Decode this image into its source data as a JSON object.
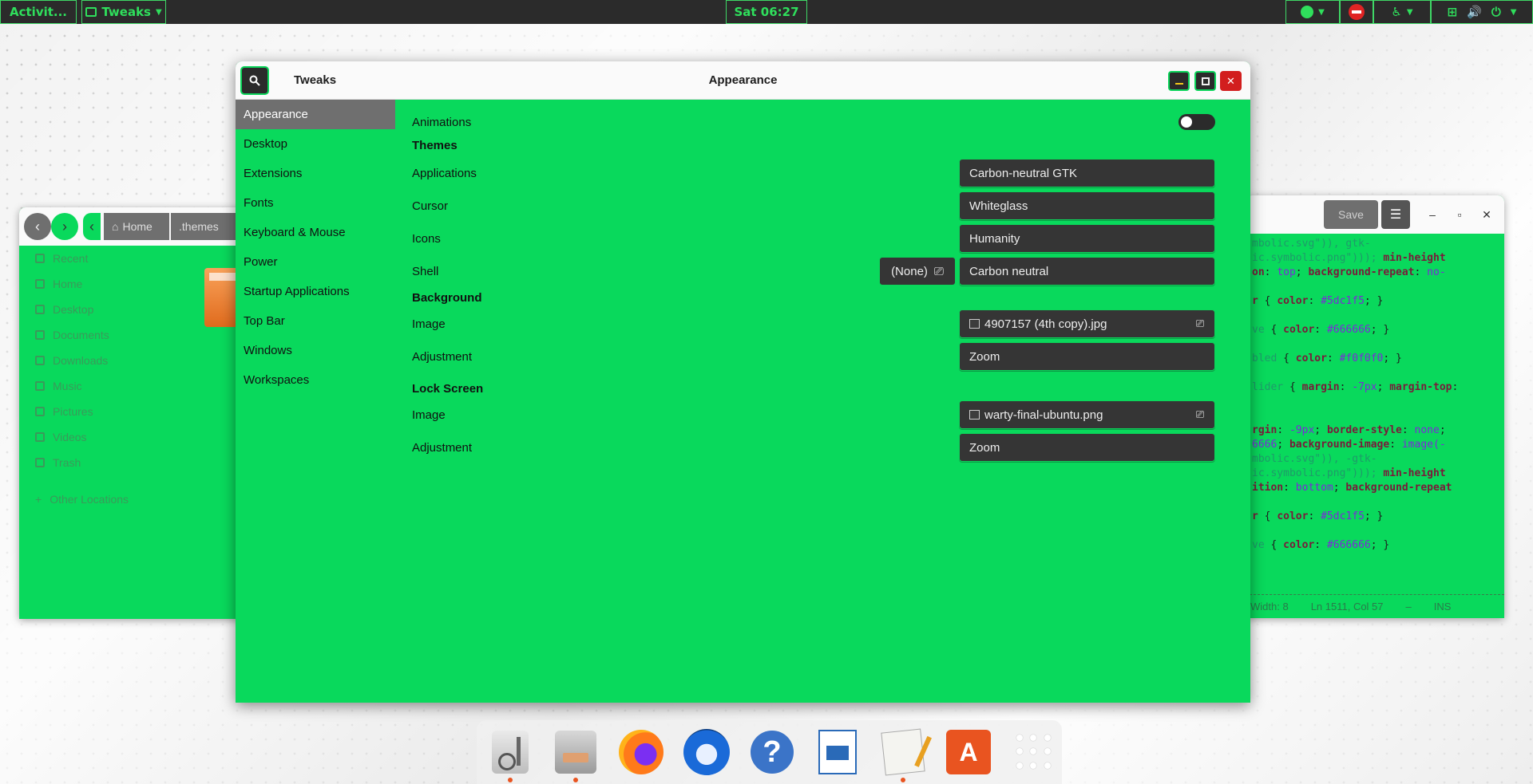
{
  "topbar": {
    "activities": "Activit...",
    "app_menu": "Tweaks",
    "clock": "Sat 06:27"
  },
  "files": {
    "crumbs": [
      "Home",
      ".themes"
    ],
    "sidebar": [
      "Recent",
      "Home",
      "Desktop",
      "Documents",
      "Downloads",
      "Music",
      "Pictures",
      "Videos",
      "Trash",
      "Other Locations"
    ]
  },
  "editor": {
    "save_label": "Save",
    "status_width": "Width: 8",
    "status_pos": "Ln 1511, Col 57",
    "status_ins": "INS"
  },
  "tweaks": {
    "app_title": "Tweaks",
    "title": "Appearance",
    "sidebar": [
      "Appearance",
      "Desktop",
      "Extensions",
      "Fonts",
      "Keyboard & Mouse",
      "Power",
      "Startup Applications",
      "Top Bar",
      "Windows",
      "Workspaces"
    ],
    "animations_label": "Animations",
    "animations_on": false,
    "themes_header": "Themes",
    "applications_label": "Applications",
    "applications_value": "Carbon-neutral GTK",
    "cursor_label": "Cursor",
    "cursor_value": "Whiteglass",
    "icons_label": "Icons",
    "icons_value": "Humanity",
    "shell_label": "Shell",
    "shell_none": "(None)",
    "shell_value": "Carbon neutral",
    "background_header": "Background",
    "bg_image_label": "Image",
    "bg_image_value": "4907157 (4th copy).jpg",
    "bg_adjust_label": "Adjustment",
    "bg_adjust_value": "Zoom",
    "lock_header": "Lock Screen",
    "lock_image_label": "Image",
    "lock_image_value": "warty-final-ubuntu.png",
    "lock_adjust_label": "Adjustment",
    "lock_adjust_value": "Zoom"
  },
  "colors": {
    "accent_green": "#09d95c",
    "topbar_bg": "#2b2b2b",
    "combo_bg": "#353535",
    "selected_bg": "#6f6f6f"
  }
}
